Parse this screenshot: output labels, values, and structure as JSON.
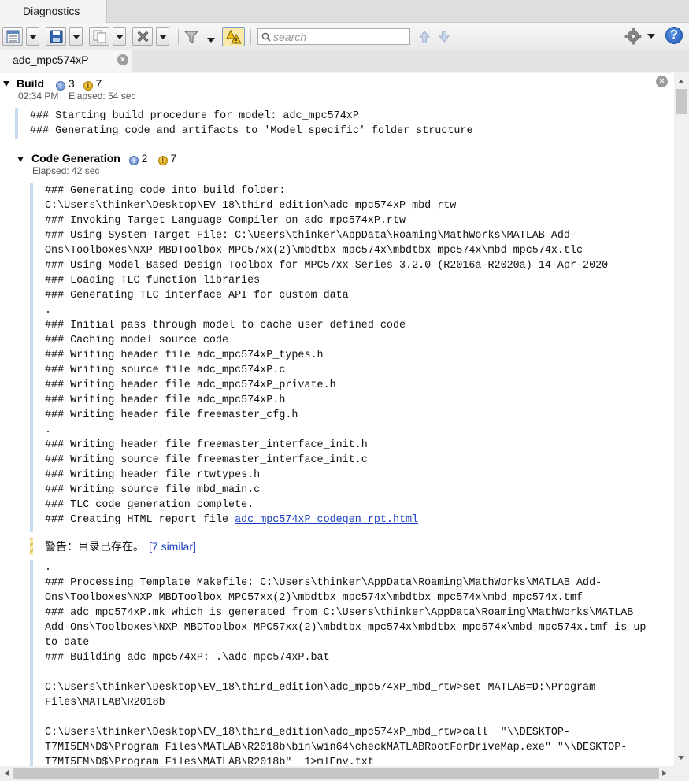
{
  "window": {
    "tab_title": "Diagnostics"
  },
  "toolbar": {
    "search_placeholder": "search",
    "icons": [
      "view-icon",
      "save-icon",
      "copy-icon",
      "clear-icon",
      "filter-icon",
      "warning-toggle-icon",
      "search-icon",
      "previous-icon",
      "next-icon",
      "gear-icon",
      "help-icon"
    ],
    "help_glyph": "?"
  },
  "file_tab": {
    "label": "adc_mpc574xP",
    "close_glyph": "×"
  },
  "build": {
    "title": "Build",
    "info_count": "3",
    "warn_count": "7",
    "time": "02:34 PM",
    "elapsed": "Elapsed: 54 sec",
    "log": "### Starting build procedure for model: adc_mpc574xP\n### Generating code and artifacts to 'Model specific' folder structure"
  },
  "codegen": {
    "title": "Code Generation",
    "info_count": "2",
    "warn_count": "7",
    "elapsed": "Elapsed: 42 sec",
    "log": "### Generating code into build folder:\nC:\\Users\\thinker\\Desktop\\EV_18\\third_edition\\adc_mpc574xP_mbd_rtw\n### Invoking Target Language Compiler on adc_mpc574xP.rtw\n### Using System Target File: C:\\Users\\thinker\\AppData\\Roaming\\MathWorks\\MATLAB Add-\nOns\\Toolboxes\\NXP_MBDToolbox_MPC57xx(2)\\mbdtbx_mpc574x\\mbdtbx_mpc574x\\mbd_mpc574x.tlc\n### Using Model-Based Design Toolbox for MPC57xx Series 3.2.0 (R2016a-R2020a) 14-Apr-2020\n### Loading TLC function libraries\n### Generating TLC interface API for custom data\n.\n### Initial pass through model to cache user defined code\n### Caching model source code\n### Writing header file adc_mpc574xP_types.h\n### Writing source file adc_mpc574xP.c\n### Writing header file adc_mpc574xP_private.h\n### Writing header file adc_mpc574xP.h\n### Writing header file freemaster_cfg.h\n.\n### Writing header file freemaster_interface_init.h\n### Writing source file freemaster_interface_init.c\n### Writing header file rtwtypes.h\n### Writing source file mbd_main.c\n### TLC code generation complete.",
    "report_prefix": "### Creating HTML report file ",
    "report_link": "adc_mpc574xP_codegen_rpt.html",
    "warning_text": "警告：目录已存在。",
    "similar_link": "[7 similar]",
    "log2": ".\n### Processing Template Makefile: C:\\Users\\thinker\\AppData\\Roaming\\MathWorks\\MATLAB Add-\nOns\\Toolboxes\\NXP_MBDToolbox_MPC57xx(2)\\mbdtbx_mpc574x\\mbdtbx_mpc574x\\mbd_mpc574x.tmf\n### adc_mpc574xP.mk which is generated from C:\\Users\\thinker\\AppData\\Roaming\\MathWorks\\MATLAB\nAdd-Ons\\Toolboxes\\NXP_MBDToolbox_MPC57xx(2)\\mbdtbx_mpc574x\\mbdtbx_mpc574x\\mbd_mpc574x.tmf is up\nto date\n### Building adc_mpc574xP: .\\adc_mpc574xP.bat\n\nC:\\Users\\thinker\\Desktop\\EV_18\\third_edition\\adc_mpc574xP_mbd_rtw>set MATLAB=D:\\Program\nFiles\\MATLAB\\R2018b\n\nC:\\Users\\thinker\\Desktop\\EV_18\\third_edition\\adc_mpc574xP_mbd_rtw>call  \"\\\\DESKTOP-\nT7MI5EM\\D$\\Program Files\\MATLAB\\R2018b\\bin\\win64\\checkMATLABRootForDriveMap.exe\" \"\\\\DESKTOP-\nT7MI5EM\\D$\\Program Files\\MATLAB\\R2018b\"  1>mlEnv.txt"
  },
  "colors": {
    "accent_bar": "#c9dced",
    "link": "#1a3fbf",
    "warning": "#e8b020",
    "info": "#5f88c9"
  }
}
